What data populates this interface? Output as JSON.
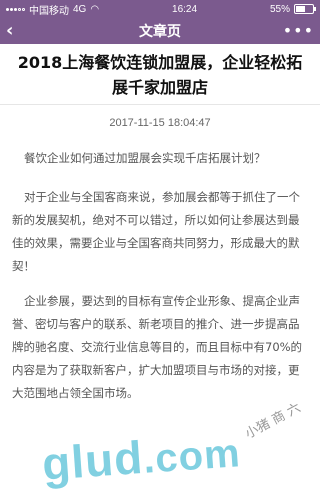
{
  "status_bar": {
    "carrier": "中国移动",
    "network": "4G",
    "time": "16:24",
    "battery_percent": "55%",
    "battery_level": 0.55
  },
  "nav": {
    "back_icon": "chevron-left",
    "title": "文章页",
    "more_icon": "more-dots",
    "more_label": "•••"
  },
  "article": {
    "title": "2018上海餐饮连锁加盟展，企业轻松拓展千家加盟店",
    "date": "2017-11-15 18:04:47",
    "paragraphs": [
      "餐饮企业如何通过加盟展会实现千店拓展计划？",
      "对于企业与全国客商来说，参加展会都等于抓住了一个新的发展契机，绝对不可以错过，所以如何让参展达到最佳的效果，需要企业与全国客商共同努力，形成最大的默契！",
      "企业参展，要达到的目标有宣传企业形象、提高企业声誉、密切与客户的联系、新老项目的推介、进一步提高品牌的驰名度、交流行业信息等目的，而且目标中有70%的内容是为了获取新客户，扩大加盟项目与市场的对接，更大范围地占领全国市场。"
    ]
  },
  "watermark": {
    "text": "glud",
    "suffix": ".com",
    "stamp": "小猪 商  六"
  }
}
